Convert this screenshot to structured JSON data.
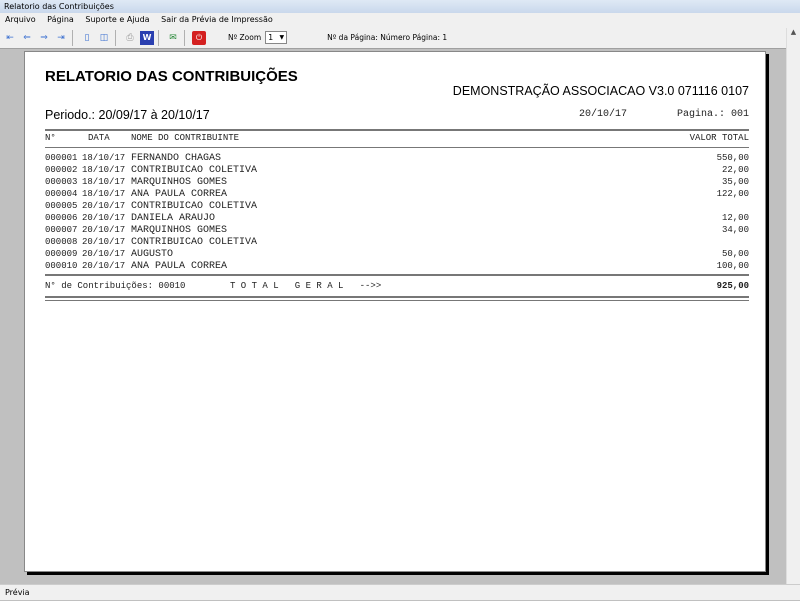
{
  "window": {
    "title": "Relatorio das Contribuições"
  },
  "menu": [
    "Arquivo",
    "Página",
    "Suporte e Ajuda",
    "Sair da Prévia de Impressão"
  ],
  "toolbar": {
    "zoom_label": "Nº Zoom",
    "zoom_value": "1",
    "page_label": "Nº da Página: Número Página: 1"
  },
  "report": {
    "title": "RELATORIO DAS CONTRIBUIÇÕES",
    "company": "DEMONSTRAÇÃO ASSOCIACAO V3.0 071116 0107",
    "period": "Periodo.: 20/09/17 à 20/10/17",
    "date": "20/10/17",
    "page": "Pagina.: 001",
    "headers": {
      "num": "N°",
      "date": "DATA",
      "name": "NOME DO CONTRIBUINTE",
      "value": "VALOR TOTAL"
    },
    "rows": [
      {
        "num": "000001",
        "date": "18/10/17",
        "name": "FERNANDO CHAGAS",
        "value": "550,00"
      },
      {
        "num": "000002",
        "date": "18/10/17",
        "name": "CONTRIBUICAO COLETIVA",
        "value": "22,00"
      },
      {
        "num": "000003",
        "date": "18/10/17",
        "name": "MARQUINHOS GOMES",
        "value": "35,00"
      },
      {
        "num": "000004",
        "date": "18/10/17",
        "name": "ANA PAULA CORREA",
        "value": "122,00"
      },
      {
        "num": "000005",
        "date": "20/10/17",
        "name": "CONTRIBUICAO COLETIVA",
        "value": ""
      },
      {
        "num": "000006",
        "date": "20/10/17",
        "name": "DANIELA ARAUJO",
        "value": "12,00"
      },
      {
        "num": "000007",
        "date": "20/10/17",
        "name": "MARQUINHOS GOMES",
        "value": "34,00"
      },
      {
        "num": "000008",
        "date": "20/10/17",
        "name": "CONTRIBUICAO COLETIVA",
        "value": ""
      },
      {
        "num": "000009",
        "date": "20/10/17",
        "name": "AUGUSTO",
        "value": "50,00"
      },
      {
        "num": "000010",
        "date": "20/10/17",
        "name": "ANA PAULA CORREA",
        "value": "100,00"
      }
    ],
    "count_label": "N° de Contribuições: 00010",
    "total_label": "T O T A L   G E R A L   -->>",
    "total_value": "925,00"
  },
  "status": {
    "text": "Prévia"
  }
}
